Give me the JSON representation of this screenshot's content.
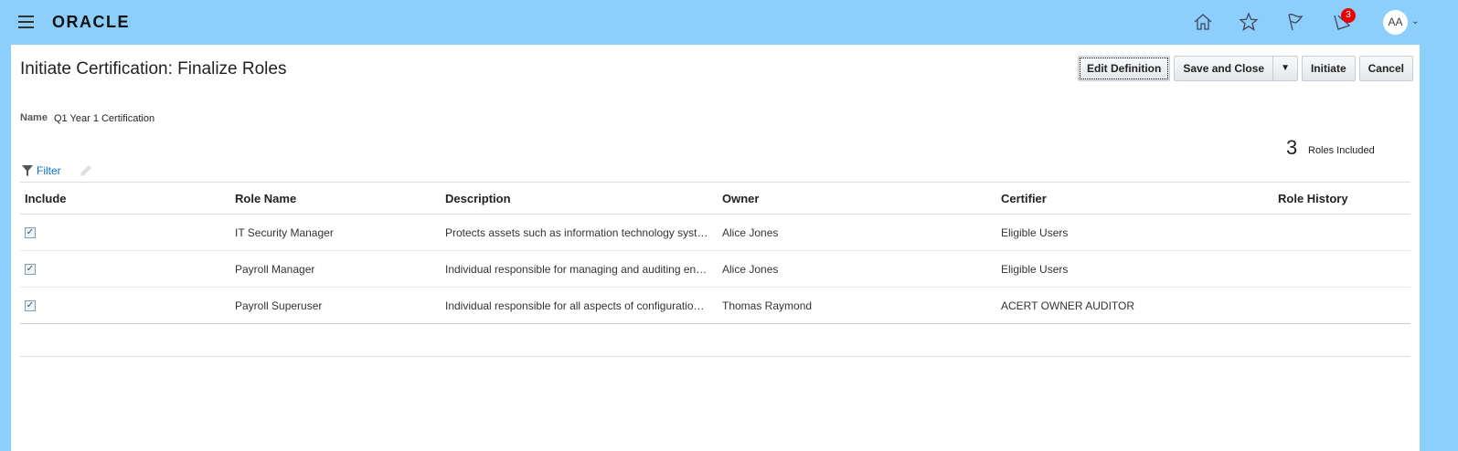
{
  "header": {
    "logo": "ORACLE",
    "notification_count": "3",
    "avatar_initials": "AA"
  },
  "page": {
    "title": "Initiate Certification: Finalize Roles",
    "buttons": {
      "edit_definition": "Edit Definition",
      "save_and_close": "Save and Close",
      "initiate": "Initiate",
      "cancel": "Cancel"
    },
    "name_label": "Name",
    "name_value": "Q1 Year 1 Certification",
    "roles_count": "3",
    "roles_label": "Roles Included",
    "filter_label": "Filter"
  },
  "table": {
    "columns": [
      "Include",
      "Role Name",
      "Description",
      "Owner",
      "Certifier",
      "Role History"
    ],
    "rows": [
      {
        "include": true,
        "role": "IT Security Manager",
        "description": "Protects assets such as information technology syst…",
        "owner": "Alice Jones",
        "certifier": "Eligible Users",
        "history": ""
      },
      {
        "include": true,
        "role": "Payroll Manager",
        "description": "Individual responsible for managing and auditing en…",
        "owner": "Alice Jones",
        "certifier": "Eligible Users",
        "history": ""
      },
      {
        "include": true,
        "role": "Payroll Superuser",
        "description": "Individual responsible for all aspects of configuratio…",
        "owner": "Thomas Raymond",
        "certifier": "ACERT OWNER AUDITOR",
        "history": ""
      }
    ]
  }
}
